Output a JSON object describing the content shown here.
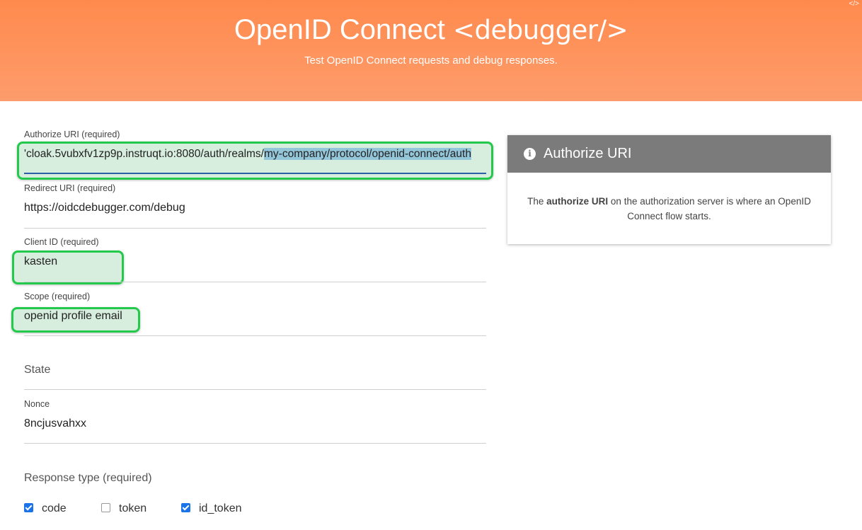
{
  "header": {
    "title_main": "OpenID Connect",
    "title_code": "<debugger/>",
    "subtitle": "Test OpenID Connect requests and debug responses."
  },
  "form": {
    "authorize_uri": {
      "label": "Authorize URI (required)",
      "value_prefix": "'cloak.5vubxfv1zp9p.instruqt.io:8080/auth/realms/",
      "value_selected": "my-company/protocol/openid-connect/auth"
    },
    "redirect_uri": {
      "label": "Redirect URI (required)",
      "value": "https://oidcdebugger.com/debug"
    },
    "client_id": {
      "label": "Client ID (required)",
      "value": "kasten"
    },
    "scope": {
      "label": "Scope (required)",
      "value": "openid profile email"
    },
    "state": {
      "placeholder": "State"
    },
    "nonce": {
      "label": "Nonce",
      "value": "8ncjusvahxx"
    },
    "response_type": {
      "label": "Response type (required)",
      "options": [
        {
          "label": "code",
          "checked": true
        },
        {
          "label": "token",
          "checked": false
        },
        {
          "label": "id_token",
          "checked": true
        }
      ]
    }
  },
  "info_panel": {
    "title": "Authorize URI",
    "body_prefix": "The ",
    "body_bold": "authorize URI",
    "body_suffix": " on the authorization server is where an OpenID Connect flow starts."
  },
  "colors": {
    "header": "#ff8a4d",
    "highlight": "#22c94a",
    "panel_head": "#7b7b7b",
    "checkbox": "#1a73e8"
  },
  "icons": {
    "info": "info-circle-icon",
    "code": "code-icon"
  }
}
